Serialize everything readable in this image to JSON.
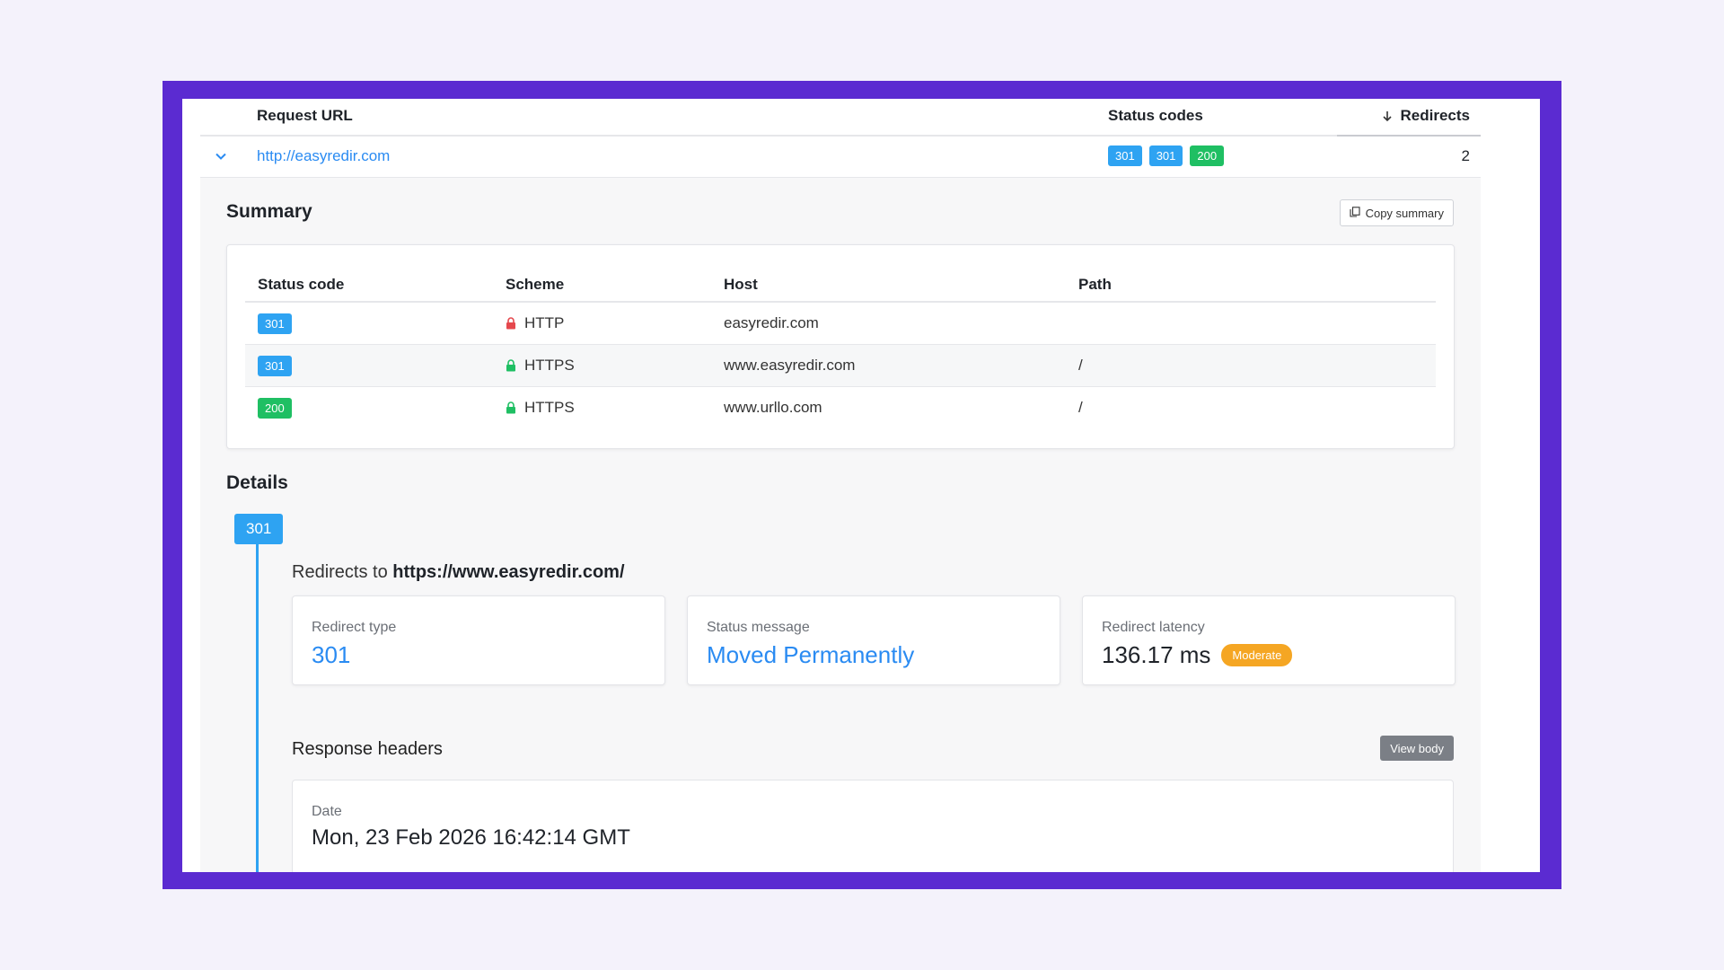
{
  "table": {
    "headers": {
      "request_url": "Request URL",
      "status_codes": "Status codes",
      "redirects": "Redirects"
    },
    "row": {
      "url": "http://easyredir.com",
      "codes": [
        {
          "code": "301",
          "color": "#2ea3f2"
        },
        {
          "code": "301",
          "color": "#2ea3f2"
        },
        {
          "code": "200",
          "color": "#1fbf63"
        }
      ],
      "redirects": "2"
    }
  },
  "summary": {
    "title": "Summary",
    "copy_label": "Copy summary",
    "columns": [
      "Status code",
      "Scheme",
      "Host",
      "Path"
    ],
    "rows": [
      {
        "code": "301",
        "scheme": "HTTP",
        "secure": false,
        "host": "easyredir.com",
        "path": ""
      },
      {
        "code": "301",
        "scheme": "HTTPS",
        "secure": true,
        "host": "www.easyredir.com",
        "path": "/"
      },
      {
        "code": "200",
        "scheme": "HTTPS",
        "secure": true,
        "host": "www.urllo.com",
        "path": "/"
      }
    ]
  },
  "details": {
    "title": "Details",
    "step_code": "301",
    "redirects_prefix": "Redirects to",
    "redirects_url": "https://www.easyredir.com/",
    "metrics": {
      "redirect_type_label": "Redirect type",
      "redirect_type_value": "301",
      "status_message_label": "Status message",
      "status_message_value": "Moved Permanently",
      "latency_label": "Redirect latency",
      "latency_value": "136.17 ms",
      "latency_rating": "Moderate"
    },
    "response_headers_title": "Response headers",
    "view_body_label": "View body",
    "header_name": "Date",
    "header_value": "Mon, 23 Feb 2026 16:42:14 GMT"
  },
  "colors": {
    "accent": "#2a8bf2",
    "frame": "#5b2bd1",
    "badge_301": "#2ea3f2",
    "badge_200": "#1fbf63",
    "moderate": "#f5a623",
    "lock_insecure": "#e5484d",
    "lock_secure": "#1fbf63"
  }
}
